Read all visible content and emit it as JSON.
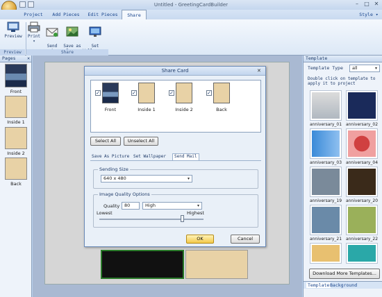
{
  "window": {
    "title": "Untitled - GreetingCardBuilder",
    "style_label": "Style",
    "min": "–",
    "max": "□",
    "close": "✕"
  },
  "tabs": [
    "Project",
    "Add Pieces",
    "Edit Pieces",
    "Share"
  ],
  "ribbon": {
    "preview": "Preview",
    "preview_group": "Preview",
    "print": "Print",
    "send_via_email": "Send via\nEmail",
    "save_as_image": "Save as\nImage",
    "set_wallpaper": "Set\nWallpaper",
    "share_group": "Share"
  },
  "pages_panel": {
    "title": "Pages",
    "close": "✕",
    "pages": [
      "Front",
      "Inside 1",
      "Inside 2",
      "Back"
    ]
  },
  "template_panel": {
    "title": "Template",
    "type_label": "Template Type",
    "type_value": "all",
    "instruction": "Double click on template to apply it to project",
    "templates": [
      "anniversary_01",
      "anniversary_02",
      "anniversary_03",
      "anniversary_04",
      "anniversary_19",
      "anniversary_20",
      "anniversary_21",
      "anniversary_22"
    ],
    "download_button": "Download More Templates...",
    "bottom_tabs": [
      "Template",
      "Background"
    ]
  },
  "dialog": {
    "title": "Share Card",
    "close": "✕",
    "cards": [
      "Front",
      "Inside 1",
      "Inside 2",
      "Back"
    ],
    "select_all": "Select All",
    "unselect_all": "Unselect All",
    "tabs": [
      "Save As Picture",
      "Set Wallpaper",
      "Send Mail"
    ],
    "sending_size_label": "Sending Size",
    "sending_size_value": "640 x 480",
    "image_quality_label": "Image Quality Options",
    "quality_label": "Quality",
    "quality_value": "80",
    "quality_level": "High",
    "lowest": "Lowest",
    "highest": "Highest",
    "ok": "OK",
    "cancel": "Cancel"
  },
  "colors": {
    "accent": "#15428b",
    "ribbon_bg": "#dce8f6",
    "ok_button": "#f3c94a"
  }
}
